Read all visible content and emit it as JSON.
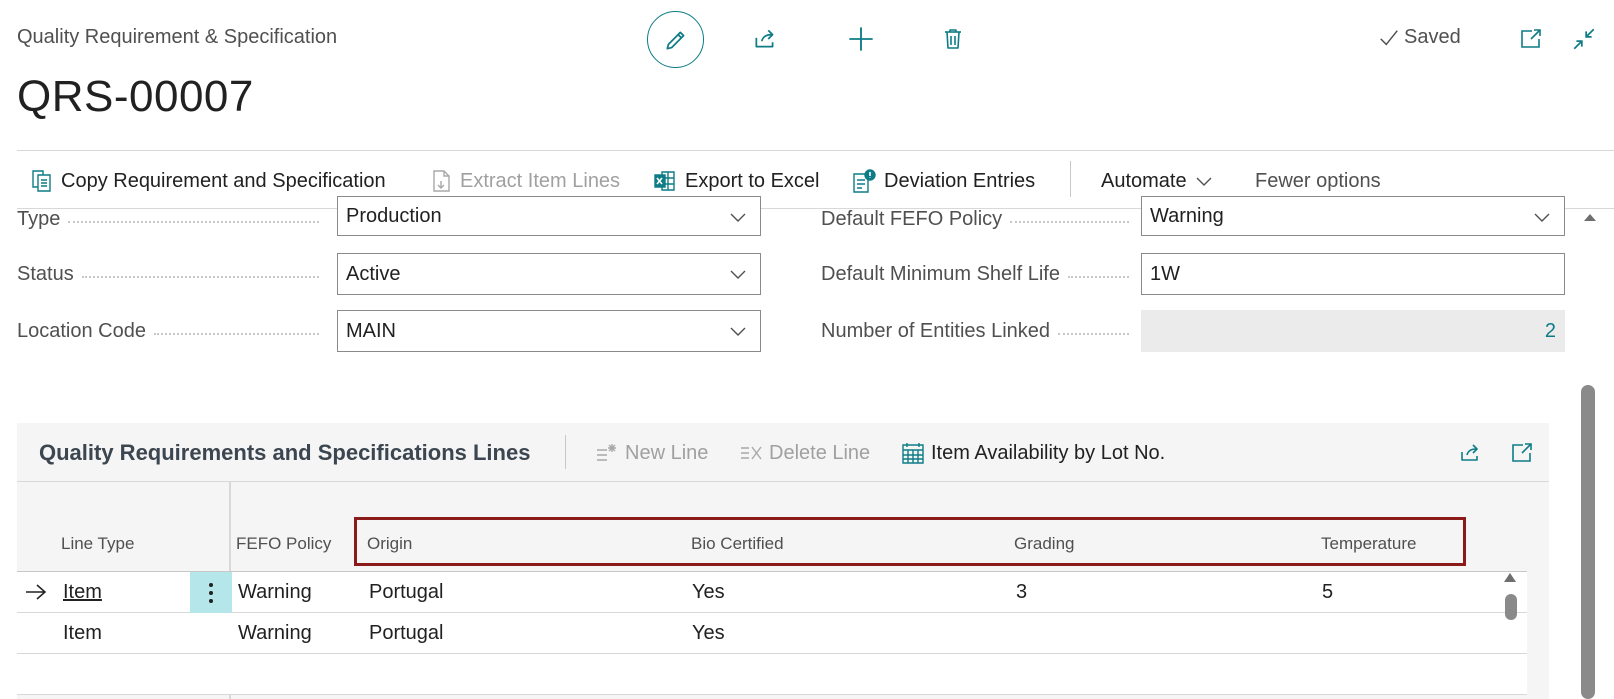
{
  "header": {
    "app_title": "Quality Requirement & Specification",
    "record_no": "QRS-00007",
    "saved_label": "Saved",
    "icons": [
      "edit-icon",
      "share-icon",
      "plus-icon",
      "trash-icon",
      "check-icon",
      "popout-icon",
      "collapse-icon"
    ]
  },
  "actions": {
    "copy": "Copy Requirement and Specification",
    "extract": "Extract Item Lines",
    "export": "Export to Excel",
    "deviation": "Deviation Entries",
    "automate": "Automate",
    "fewer": "Fewer options"
  },
  "fields": {
    "type": {
      "label": "Type",
      "value": "Production"
    },
    "status": {
      "label": "Status",
      "value": "Active"
    },
    "location": {
      "label": "Location Code",
      "value": "MAIN"
    },
    "fefo": {
      "label": "Default FEFO Policy",
      "value": "Warning"
    },
    "shelf_life": {
      "label": "Default Minimum Shelf Life",
      "value": "1W"
    },
    "entities": {
      "label": "Number of Entities Linked",
      "value": "2"
    }
  },
  "lines": {
    "title": "Quality Requirements and Specifications Lines",
    "new_line": "New Line",
    "delete_line": "Delete Line",
    "availability": "Item Availability by Lot No.",
    "columns": [
      "Line Type",
      "FEFO Policy",
      "Origin",
      "Bio Certified",
      "Grading",
      "Temperature"
    ],
    "rows": [
      {
        "line_type": "Item",
        "fefo": "Warning",
        "origin": "Portugal",
        "bio": "Yes",
        "grading": "3",
        "temperature": "5"
      },
      {
        "line_type": "Item",
        "fefo": "Warning",
        "origin": "Portugal",
        "bio": "Yes",
        "grading": "",
        "temperature": ""
      }
    ]
  },
  "colors": {
    "accent": "#0e7c86",
    "highlight": "#8b1a1a",
    "selected_cell": "#b4e6ea"
  }
}
